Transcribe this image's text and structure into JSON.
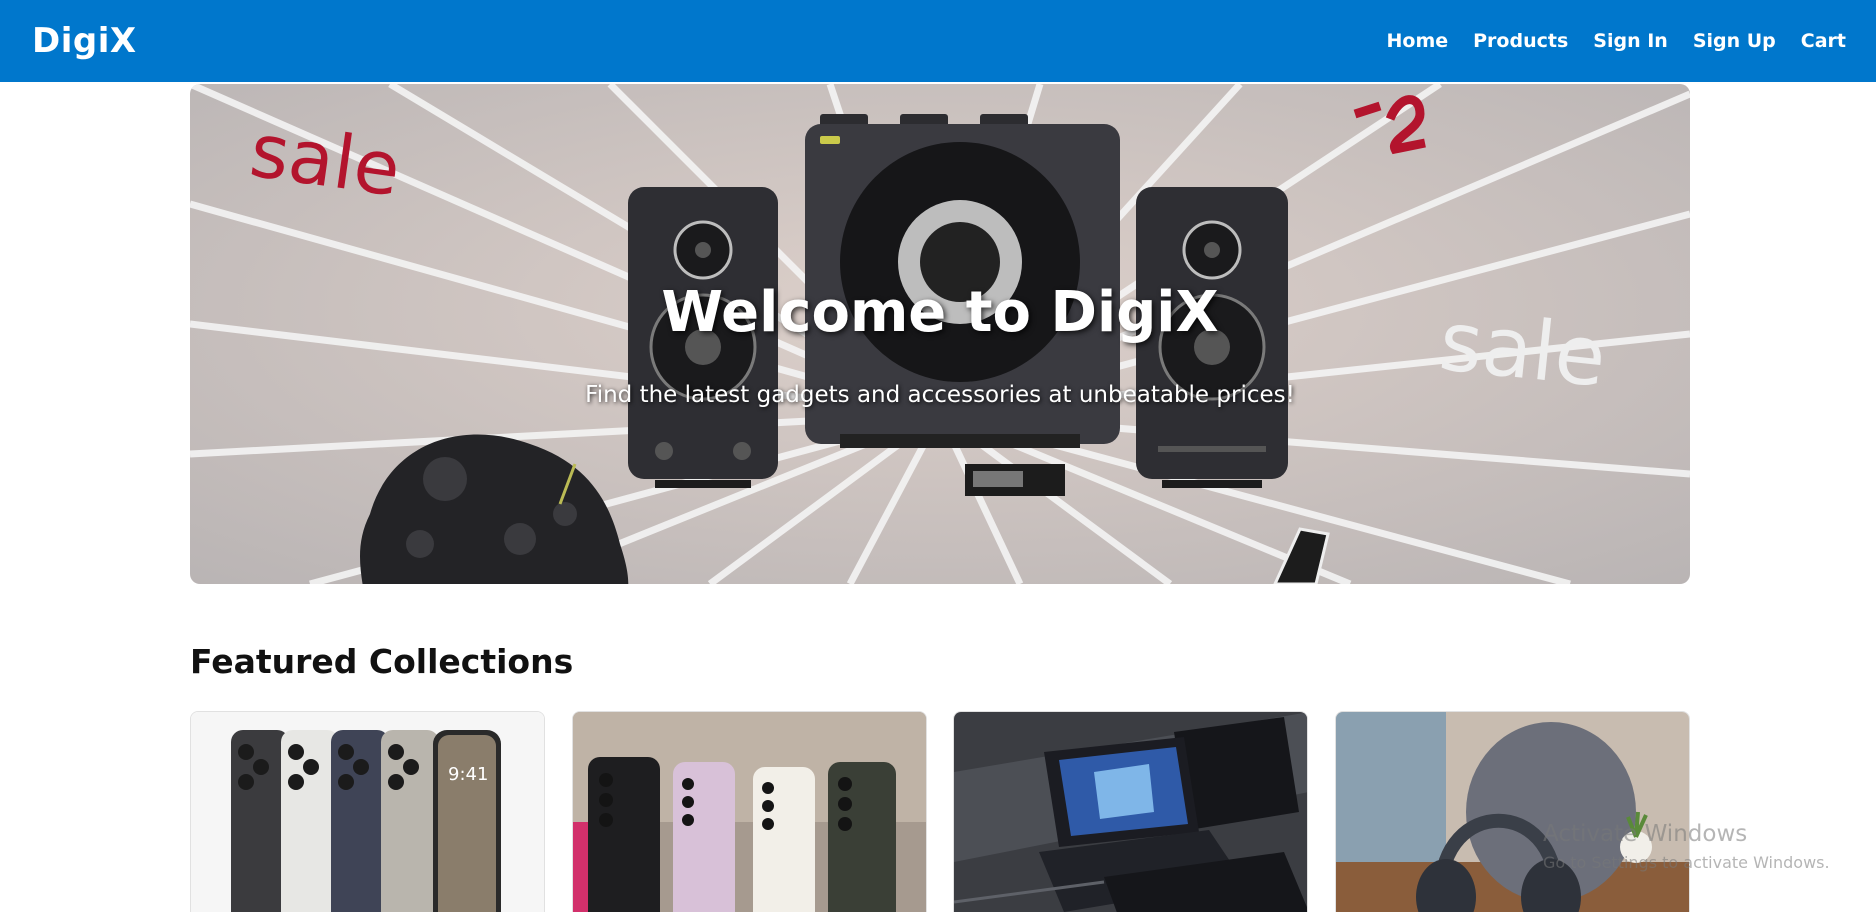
{
  "navbar": {
    "brand": "DigiX",
    "links": [
      "Home",
      "Products",
      "Sign In",
      "Sign Up",
      "Cart"
    ]
  },
  "hero": {
    "title": "Welcome to DigiX",
    "subtitle": "Find the latest gadgets and accessories at unbeatable prices!",
    "image_text": {
      "sale_left": "sale",
      "sale_right": "sale"
    }
  },
  "featured": {
    "title": "Featured Collections",
    "cards": [
      {
        "name": "iphone-lineup",
        "screen_time": "9:41"
      },
      {
        "name": "galaxy-phones"
      },
      {
        "name": "gaming-laptops"
      },
      {
        "name": "headphones"
      }
    ]
  },
  "watermark": {
    "title": "Activate Windows",
    "subtitle": "Go to Settings to activate Windows."
  },
  "colors": {
    "nav_bg": "#0077cc",
    "accent": "#0077cc",
    "text": "#111111"
  }
}
